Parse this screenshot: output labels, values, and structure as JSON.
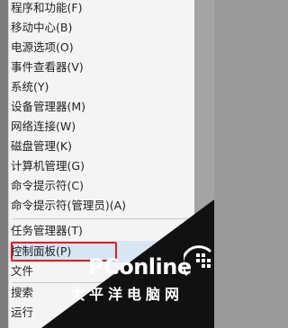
{
  "menu": {
    "items": [
      {
        "label": "程序和功能(F)"
      },
      {
        "label": "移动中心(B)"
      },
      {
        "label": "电源选项(O)"
      },
      {
        "label": "事件查看器(V)"
      },
      {
        "label": "系统(Y)"
      },
      {
        "label": "设备管理器(M)"
      },
      {
        "label": "网络连接(W)"
      },
      {
        "label": "磁盘管理(K)"
      },
      {
        "label": "计算机管理(G)"
      },
      {
        "label": "命令提示符(C)"
      },
      {
        "label": "命令提示符(管理员)(A)"
      },
      {
        "label": "任务管理器(T)"
      },
      {
        "label": "控制面板(P)"
      },
      {
        "label": "文件"
      },
      {
        "label": "搜索"
      },
      {
        "label": "运行"
      }
    ]
  },
  "watermark": {
    "logo": "PConline",
    "subtitle": "太平洋电脑网"
  },
  "colors": {
    "menu_bg": "#f4f4f4",
    "highlight": "#d8e6f4",
    "outline": "#e21c1c",
    "watermark_bg": "#111111"
  }
}
